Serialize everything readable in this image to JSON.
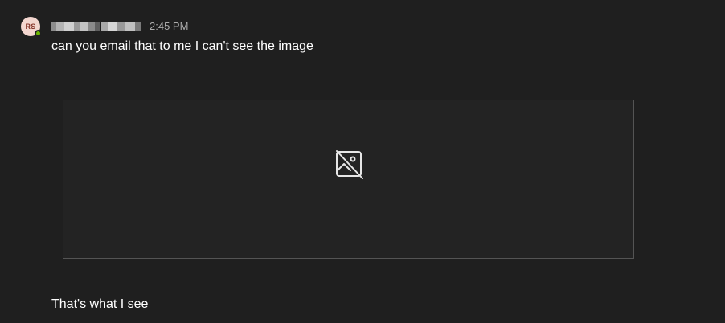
{
  "message": {
    "avatar_initials": "RS",
    "presence_status": "available",
    "sender_name_redacted": true,
    "timestamp": "2:45 PM",
    "text": "can you email that to me I can't see the image",
    "attachment_icon": "image-off-icon",
    "followup_text": "That's what I see"
  },
  "colors": {
    "background": "#1f1f1f",
    "placeholder_border": "#545454",
    "presence": "#6bb700",
    "avatar_bg": "#f3d6cf",
    "avatar_text": "#8a3a2f"
  }
}
